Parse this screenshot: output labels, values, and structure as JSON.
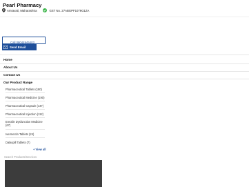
{
  "company": {
    "name": "Pearl Pharmacy",
    "location": "Amravati, Maharashtra",
    "gst": "GST No. 27ABGPF1079G1ZA"
  },
  "contact": {
    "call_label": "Call 08044945403",
    "email_label": "Send Email"
  },
  "nav": {
    "home": "Home",
    "about": "About Us",
    "contact": "Contact Us",
    "range_title": "Our Product Range"
  },
  "products": [
    "Pharmaceutical Tablets (180)",
    "Pharmaceutical Medicine (190)",
    "Pharmaceutical Capsule (147)",
    "Pharmaceutical Injection (112)",
    "Erectile Dysfunction Medicine (67)",
    "Ivermectin Tablets (24)",
    "Dalaspill Tablets (7)"
  ],
  "view_all": "+ View all",
  "search": {
    "placeholder": "Search Products/Services"
  },
  "colors": {
    "brand_blue": "#1f4f9a",
    "gst_green": "#3bb54a",
    "panel_dark": "#3c3c3c"
  },
  "icons": {
    "location": "location-pin-icon",
    "gst": "gst-badge-icon",
    "mail": "mail-icon"
  }
}
